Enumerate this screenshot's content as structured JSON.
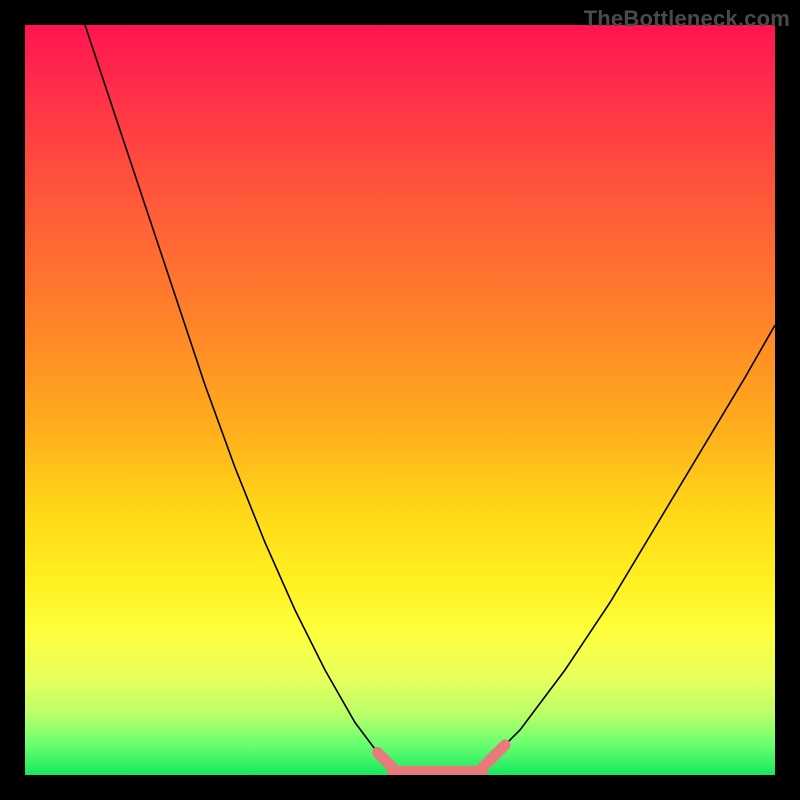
{
  "watermark": "TheBottleneck.com",
  "chart_data": {
    "type": "line",
    "title": "",
    "xlabel": "",
    "ylabel": "",
    "xlim": [
      0,
      100
    ],
    "ylim": [
      0,
      100
    ],
    "grid": false,
    "legend": false,
    "annotations": [],
    "series": [
      {
        "name": "left-curve",
        "x": [
          8,
          12,
          16,
          20,
          24,
          28,
          32,
          36,
          40,
          44,
          47,
          49
        ],
        "y": [
          100,
          88,
          76,
          64,
          52,
          41,
          31,
          22,
          14,
          7,
          3,
          1
        ]
      },
      {
        "name": "bottom-flat",
        "x": [
          49,
          52,
          55,
          58,
          61
        ],
        "y": [
          1,
          0,
          0,
          0,
          1
        ]
      },
      {
        "name": "right-curve",
        "x": [
          61,
          66,
          72,
          78,
          84,
          90,
          96,
          100
        ],
        "y": [
          1,
          6,
          14,
          23,
          33,
          43,
          53,
          60
        ]
      }
    ],
    "markers": [
      {
        "name": "left-marker",
        "x1": 47,
        "y1": 3,
        "x2": 49,
        "y2": 1
      },
      {
        "name": "bottom-marker",
        "x1": 49,
        "y1": 0.5,
        "x2": 61,
        "y2": 0.5
      },
      {
        "name": "right-marker",
        "x1": 61,
        "y1": 1,
        "x2": 64,
        "y2": 4
      }
    ]
  },
  "colors": {
    "background": "#000000",
    "curve": "#000000",
    "marker": "#e87a7b"
  }
}
